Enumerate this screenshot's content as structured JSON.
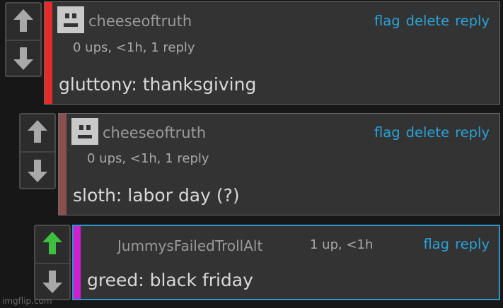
{
  "colors": {
    "background": "#171717",
    "comment_bg": "#333333",
    "link": "#2aa3d8",
    "bar_red": "#e32b2b",
    "bar_brown": "#8c4f4f",
    "bar_magenta": "#cc21d2",
    "selected_border": "#2e93c6",
    "upvote_active": "#3fbf3f",
    "vote_arrow": "#a8a8a8"
  },
  "comments": [
    {
      "username": "cheeseoftruth",
      "meta": "0 ups, <1h, 1 reply",
      "text": "gluttony: thanksgiving",
      "actions": [
        "flag",
        "delete",
        "reply"
      ],
      "upvoted": false,
      "avatar_icon": "robot-face-icon"
    },
    {
      "username": "cheeseoftruth",
      "meta": "0 ups, <1h, 1 reply",
      "text": "sloth: labor day (?)",
      "actions": [
        "flag",
        "delete",
        "reply"
      ],
      "upvoted": false,
      "avatar_icon": "robot-face-icon"
    },
    {
      "username": "JummysFailedTrollAlt",
      "meta": "1 up, <1h",
      "text": "greed: black friday",
      "actions": [
        "flag",
        "reply"
      ],
      "upvoted": true
    }
  ],
  "watermark": "imgflip.com"
}
